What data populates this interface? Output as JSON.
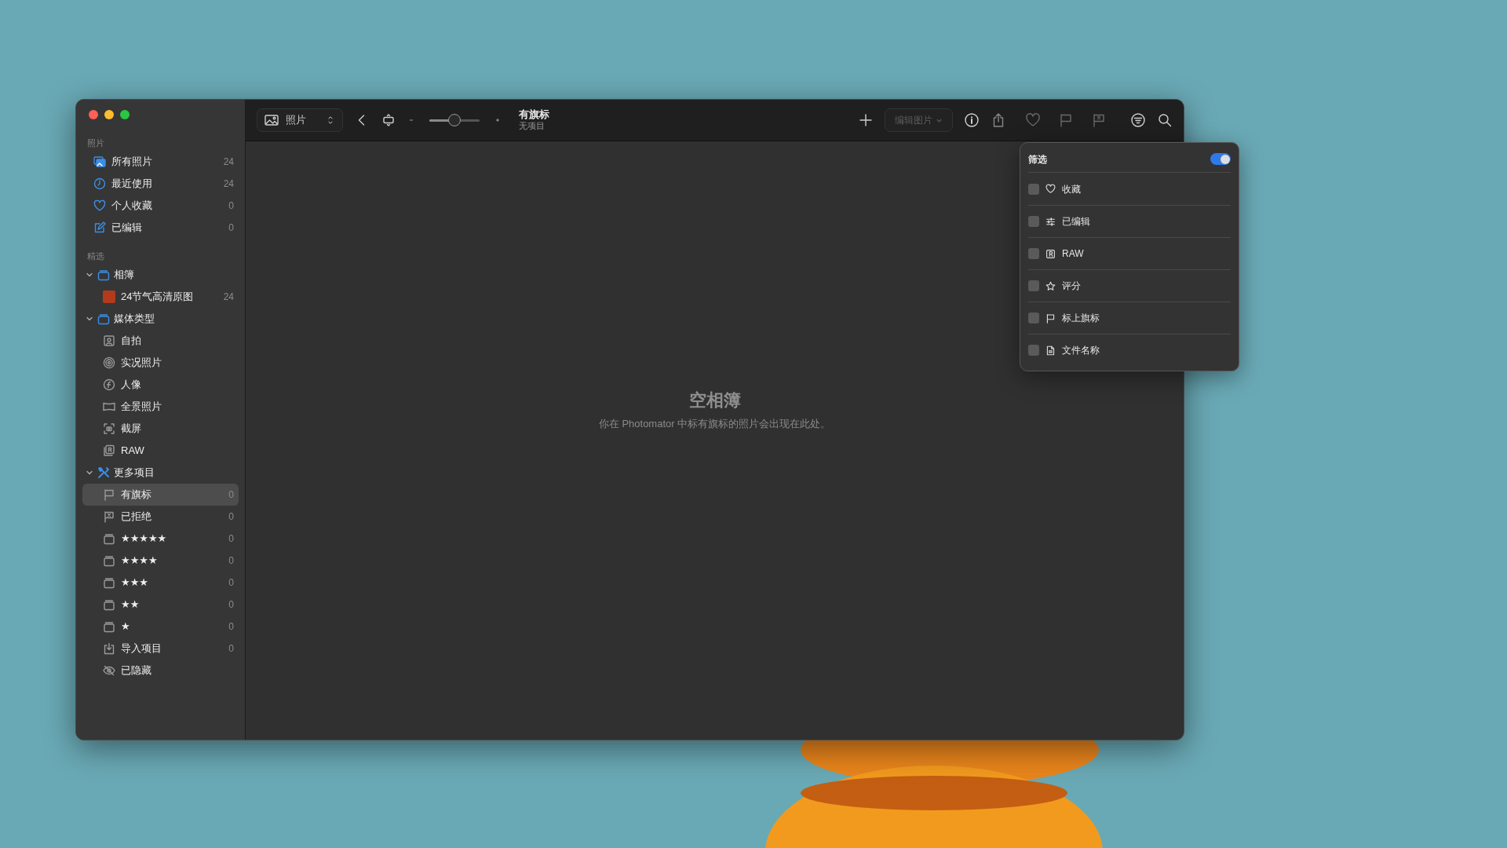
{
  "window": {
    "title": "有旗标",
    "subtitle": "无项目"
  },
  "toolbar": {
    "view_selector": "照片",
    "zoom": {
      "level": 0.5
    },
    "edit_button": {
      "label": "编辑图片",
      "disabled": true
    }
  },
  "sidebar": {
    "sections": [
      {
        "heading": "照片",
        "items": [
          {
            "label": "所有照片",
            "count": "24",
            "selected": false
          },
          {
            "label": "最近使用",
            "count": "24",
            "selected": false
          },
          {
            "label": "个人收藏",
            "count": "0",
            "selected": false
          },
          {
            "label": "已编辑",
            "count": "0",
            "selected": false
          }
        ]
      },
      {
        "heading": "精选",
        "items": [
          {
            "label": "相簿",
            "expanded": true,
            "selected": false,
            "children": [
              {
                "label": "24节气高清原图",
                "count": "24",
                "selected": false
              }
            ]
          },
          {
            "label": "媒体类型",
            "expanded": true,
            "selected": false,
            "children": [
              {
                "label": "自拍",
                "selected": false
              },
              {
                "label": "实况照片",
                "selected": false
              },
              {
                "label": "人像",
                "selected": false
              },
              {
                "label": "全景照片",
                "selected": false
              },
              {
                "label": "截屏",
                "selected": false
              },
              {
                "label": "RAW",
                "selected": false
              }
            ]
          },
          {
            "label": "更多项目",
            "expanded": true,
            "selected": false,
            "children": [
              {
                "label": "有旗标",
                "count": "0",
                "selected": true
              },
              {
                "label": "已拒绝",
                "count": "0",
                "selected": false
              },
              {
                "label": "★★★★★",
                "count": "0",
                "selected": false
              },
              {
                "label": "★★★★",
                "count": "0",
                "selected": false
              },
              {
                "label": "★★★",
                "count": "0",
                "selected": false
              },
              {
                "label": "★★",
                "count": "0",
                "selected": false
              },
              {
                "label": "★",
                "count": "0",
                "selected": false
              },
              {
                "label": "导入项目",
                "count": "0",
                "selected": false
              },
              {
                "label": "已隐藏",
                "selected": false
              }
            ]
          }
        ]
      }
    ]
  },
  "empty_state": {
    "title": "空相簿",
    "message": "你在 Photomator 中标有旗标的照片会出现在此处。"
  },
  "filter_popover": {
    "title": "筛选",
    "on": true,
    "items": [
      {
        "label": "收藏",
        "checked": false
      },
      {
        "label": "已编辑",
        "checked": false
      },
      {
        "label": "RAW",
        "checked": false
      },
      {
        "label": "评分",
        "checked": false
      },
      {
        "label": "标上旗标",
        "checked": false
      },
      {
        "label": "文件名称",
        "checked": false
      }
    ]
  }
}
